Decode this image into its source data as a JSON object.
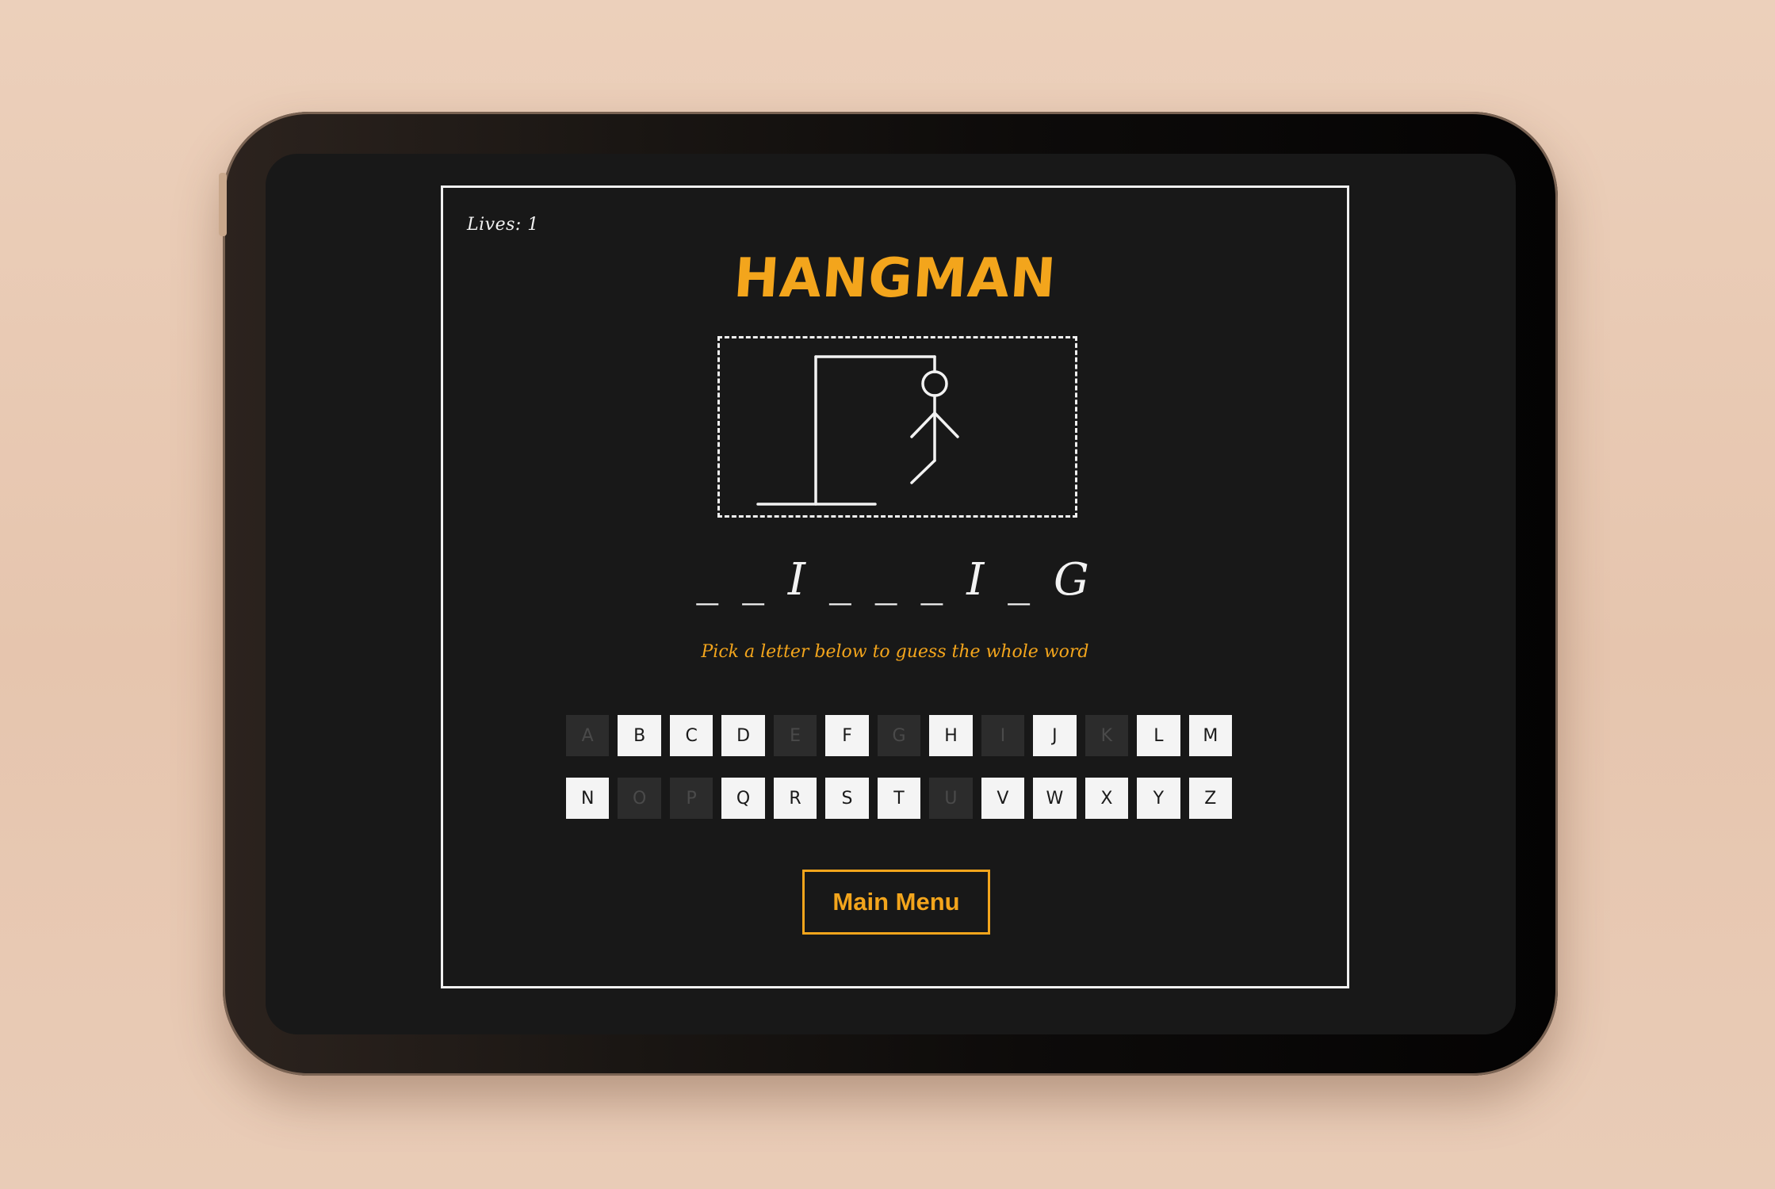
{
  "game": {
    "lives_label": "Lives: 1",
    "title": "HANGMAN",
    "word_display": "_ _ I _ _ _ I _ G",
    "hint": "Pick a letter below to guess the whole word",
    "main_menu_label": "Main Menu"
  },
  "keyboard": {
    "row1": [
      {
        "letter": "A",
        "used": true
      },
      {
        "letter": "B",
        "used": false
      },
      {
        "letter": "C",
        "used": false
      },
      {
        "letter": "D",
        "used": false
      },
      {
        "letter": "E",
        "used": true
      },
      {
        "letter": "F",
        "used": false
      },
      {
        "letter": "G",
        "used": true
      },
      {
        "letter": "H",
        "used": false
      },
      {
        "letter": "I",
        "used": true
      },
      {
        "letter": "J",
        "used": false
      },
      {
        "letter": "K",
        "used": true
      },
      {
        "letter": "L",
        "used": false
      },
      {
        "letter": "M",
        "used": false
      }
    ],
    "row2": [
      {
        "letter": "N",
        "used": false
      },
      {
        "letter": "O",
        "used": true
      },
      {
        "letter": "P",
        "used": true
      },
      {
        "letter": "Q",
        "used": false
      },
      {
        "letter": "R",
        "used": false
      },
      {
        "letter": "S",
        "used": false
      },
      {
        "letter": "T",
        "used": false
      },
      {
        "letter": "U",
        "used": true
      },
      {
        "letter": "V",
        "used": false
      },
      {
        "letter": "W",
        "used": false
      },
      {
        "letter": "X",
        "used": false
      },
      {
        "letter": "Y",
        "used": false
      },
      {
        "letter": "Z",
        "used": false
      }
    ]
  },
  "colors": {
    "accent": "#f3a51c",
    "background": "#181818",
    "key_active": "#f4f4f4",
    "key_used": "#2c2c2c"
  }
}
